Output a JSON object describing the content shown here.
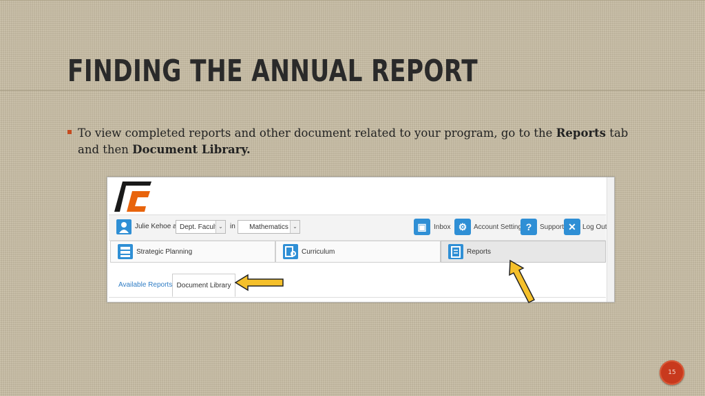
{
  "slide": {
    "title": "FINDING THE ANNUAL REPORT",
    "bullet": {
      "part1": "To view completed reports and other document related to your program, go to the ",
      "bold1": "Reports",
      "part2": " tab and then ",
      "bold2": "Document Library."
    },
    "slide_number": "15"
  },
  "app": {
    "user": {
      "label": "Julie Kehoe as",
      "role_select": "Dept. Faculty",
      "in_label": "in",
      "dept_select": "Mathematics"
    },
    "top_buttons": {
      "inbox": "Inbox",
      "account_settings": "Account Settings",
      "support": "Support",
      "logout": "Log Out"
    },
    "nav_tabs": {
      "strategic_planning": "Strategic Planning",
      "curriculum": "Curriculum",
      "reports": "Reports"
    },
    "sub_tabs": {
      "available_reports": "Available Reports",
      "document_library": "Document Library"
    }
  },
  "colors": {
    "accent_blue": "#2f8fd5",
    "arrow_yellow": "#f5c02a",
    "bullet_orange": "#c64a1e"
  }
}
